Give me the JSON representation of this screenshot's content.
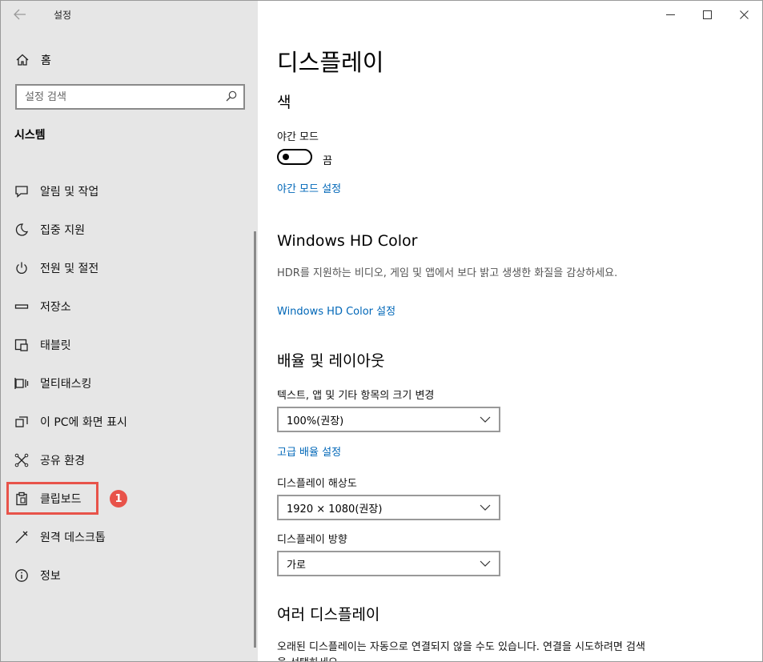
{
  "app": {
    "title": "설정",
    "back_icon": "back-arrow-icon"
  },
  "window_controls": {
    "minimize": "—",
    "maximize": "☐",
    "close": "✕"
  },
  "sidebar": {
    "home_label": "홈",
    "search_placeholder": "설정 검색",
    "section_title": "시스템",
    "items": [
      {
        "label": "알림 및 작업",
        "icon": "notification-icon"
      },
      {
        "label": "집중 지원",
        "icon": "moon-icon"
      },
      {
        "label": "전원 및 절전",
        "icon": "power-icon"
      },
      {
        "label": "저장소",
        "icon": "storage-icon"
      },
      {
        "label": "태블릿",
        "icon": "tablet-icon"
      },
      {
        "label": "멀티태스킹",
        "icon": "multitasking-icon"
      },
      {
        "label": "이 PC에 화면 표시",
        "icon": "project-icon"
      },
      {
        "label": "공유 환경",
        "icon": "share-icon"
      },
      {
        "label": "클립보드",
        "icon": "clipboard-icon"
      },
      {
        "label": "원격 데스크톱",
        "icon": "remote-desktop-icon"
      },
      {
        "label": "정보",
        "icon": "info-icon"
      }
    ],
    "highlight_badge": "1",
    "highlight_color": "#e8534a"
  },
  "main": {
    "page_title": "디스플레이",
    "color_section": {
      "title": "색",
      "night_mode_label": "야간 모드",
      "toggle_state": "끔",
      "night_mode_link": "야간 모드 설정"
    },
    "hd_color": {
      "title": "Windows HD Color",
      "description": "HDR를 지원하는 비디오, 게임 및 앱에서 보다 밝고 생생한 화질을 감상하세요.",
      "link": "Windows HD Color 설정"
    },
    "scale_layout": {
      "title": "배율 및 레이아웃",
      "text_size_label": "텍스트, 앱 및 기타 항목의 크기 변경",
      "text_size_value": "100%(권장)",
      "advanced_link": "고급 배율 설정",
      "resolution_label": "디스플레이 해상도",
      "resolution_value": "1920 × 1080(권장)",
      "orientation_label": "디스플레이 방향",
      "orientation_value": "가로"
    },
    "multi_display": {
      "title": "여러 디스플레이",
      "description": "오래된 디스플레이는 자동으로 연결되지 않을 수도 있습니다. 연결을 시도하려면 검색을 선택하세요."
    },
    "link_color": "#0067b8"
  }
}
